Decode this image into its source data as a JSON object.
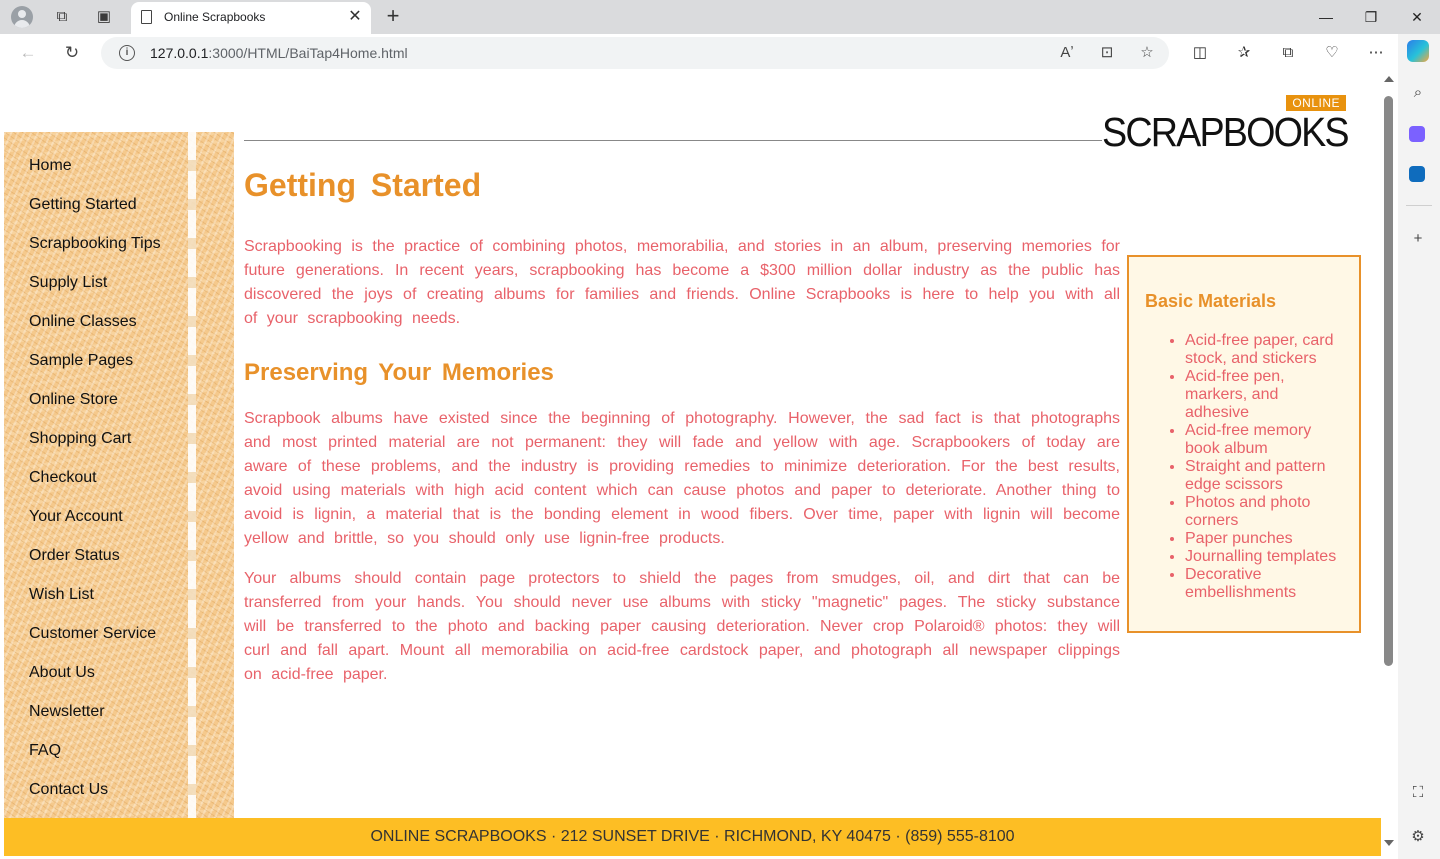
{
  "browser": {
    "tab_title": "Online Scrapbooks",
    "url_host": "127.0.0.1",
    "url_rest": ":3000/HTML/BaiTap4Home.html"
  },
  "logo": {
    "badge": "ONLINE",
    "name": "SCRAPBOOKS"
  },
  "nav": [
    "Home",
    "Getting Started",
    "Scrapbooking Tips",
    "Supply List",
    "Online Classes",
    "Sample Pages",
    "Online Store",
    "Shopping Cart",
    "Checkout",
    "Your Account",
    "Order Status",
    "Wish List",
    "Customer Service",
    "About Us",
    "Newsletter",
    "FAQ",
    "Contact Us"
  ],
  "main": {
    "title": "Getting Started",
    "intro": "Scrapbooking is the practice of combining photos, memorabilia, and stories in an album, preserving memories for future generations. In recent years, scrapbooking has become a $300 million dollar industry as the public has discovered the joys of creating albums for families and friends. Online Scrapbooks is here to help you with all of your scrapbooking needs.",
    "section_title": "Preserving Your Memories",
    "para1": "Scrapbook albums have existed since the beginning of photography. However, the sad fact is that photographs and most printed material are not permanent: they will fade and yellow with age. Scrapbookers of today are aware of these problems, and the industry is providing remedies to minimize deterioration. For the best results, avoid using materials with high acid content which can cause photos and paper to deteriorate. Another thing to avoid is lignin, a material that is the bonding element in wood fibers. Over time, paper with lignin will become yellow and brittle, so you should only use lignin-free products.",
    "para2": "Your albums should contain page protectors to shield the pages from smudges, oil, and dirt that can be transferred from your hands. You should never use albums with sticky \"magnetic\" pages. The sticky substance will be transferred to the photo and backing paper causing deterioration. Never crop Polaroid® photos: they will curl and fall apart. Mount all memorabilia on acid-free cardstock paper, and photograph all newspaper clippings on acid-free paper."
  },
  "aside": {
    "title": "Basic Materials",
    "items": [
      "Acid-free paper, card stock, and stickers",
      "Acid-free pen, markers, and adhesive",
      "Acid-free memory book album",
      "Straight and pattern edge scissors",
      "Photos and photo corners",
      "Paper punches",
      "Journalling templates",
      "Decorative embellishments"
    ]
  },
  "footer": {
    "text": "ONLINE SCRAPBOOKS · 212 SUNSET DRIVE · RICHMOND, KY 40475 · (859) 555-8100"
  },
  "colors": {
    "heading": "#e8912a",
    "body_text": "#e8626a",
    "footer_bg": "#fdbe24",
    "aside_bg": "#fff8e6"
  }
}
